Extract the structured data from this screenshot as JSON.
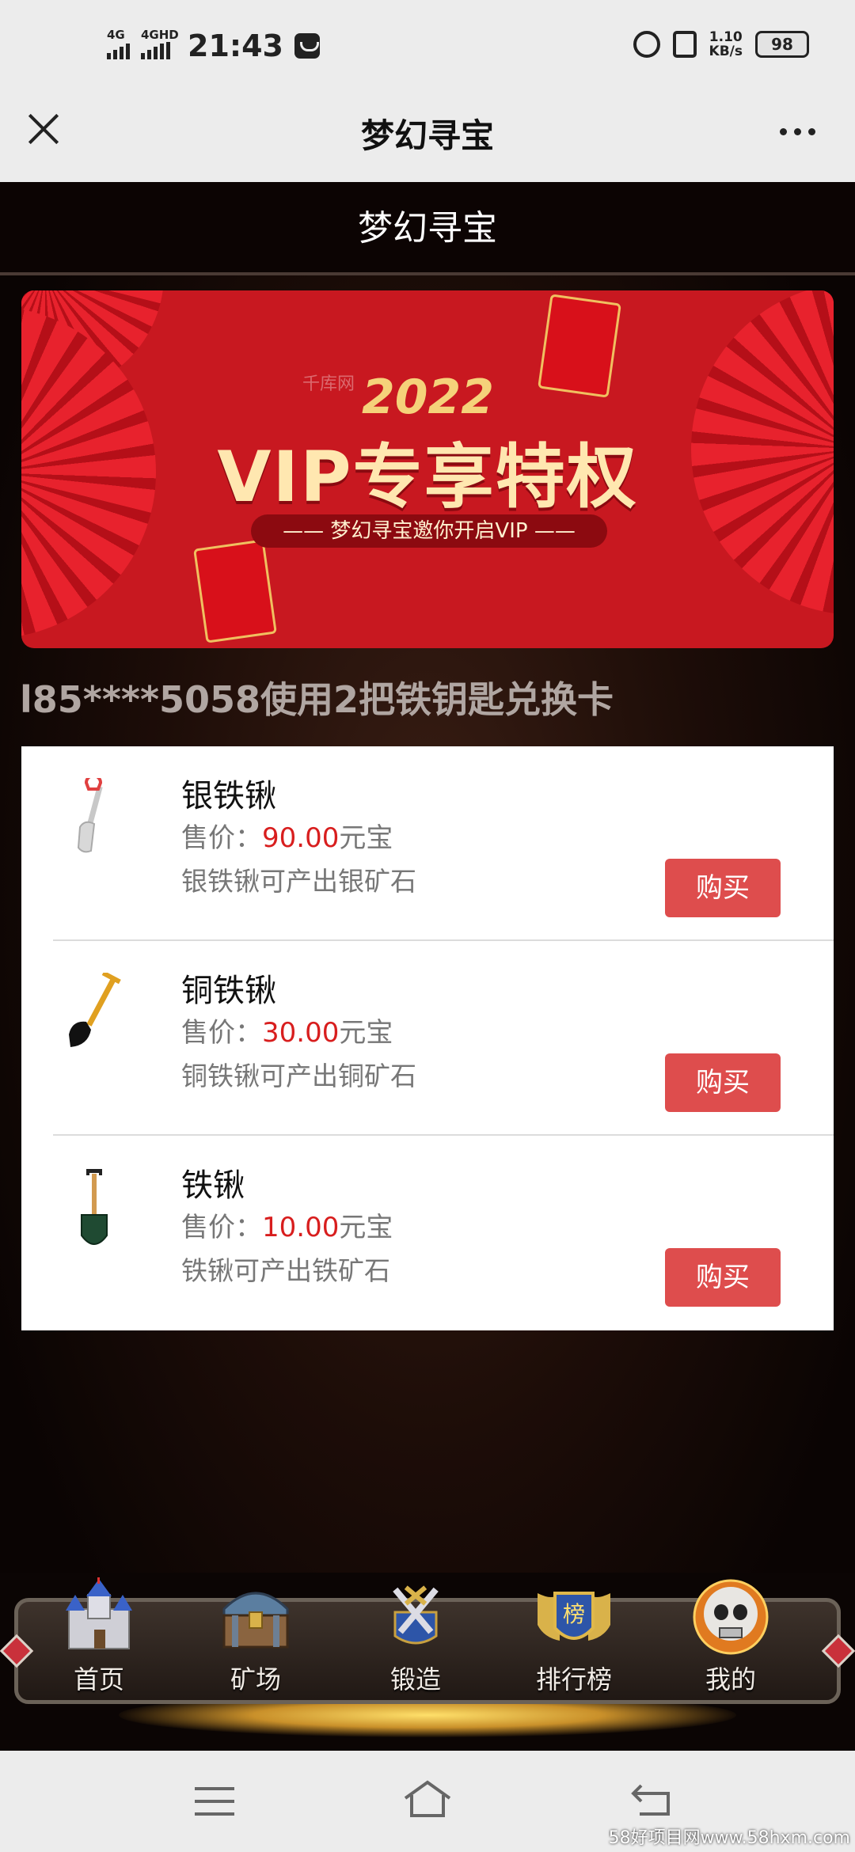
{
  "status_bar": {
    "net1": "4G",
    "net2": "4GHD",
    "time": "21:43",
    "speed_value": "1.10",
    "speed_unit": "KB/s",
    "battery": "98"
  },
  "nav": {
    "title": "梦幻寻宝"
  },
  "page": {
    "header_title": "梦幻寻宝",
    "banner": {
      "year": "2022",
      "title": "VIP专享特权",
      "subtitle": "—— 梦幻寻宝邀你开启VIP ——",
      "faint_text": "千库网"
    },
    "marquee": "l85****5058使用2把铁钥匙兑换卡"
  },
  "shop": {
    "price_label": "售价：",
    "currency": "元宝",
    "buy_label": "购买",
    "items": [
      {
        "name": "银铁锹",
        "price": "90.00",
        "desc": "银铁锹可产出银矿石",
        "icon": "silver-shovel-icon"
      },
      {
        "name": "铜铁锹",
        "price": "30.00",
        "desc": "铜铁锹可产出铜矿石",
        "icon": "copper-shovel-icon"
      },
      {
        "name": "铁锹",
        "price": "10.00",
        "desc": "铁锹可产出铁矿石",
        "icon": "iron-shovel-icon"
      }
    ]
  },
  "tabs": [
    {
      "label": "首页",
      "icon": "castle-icon"
    },
    {
      "label": "矿场",
      "icon": "treasure-chest-icon"
    },
    {
      "label": "锻造",
      "icon": "crossed-swords-icon"
    },
    {
      "label": "排行榜",
      "icon": "ranking-shield-icon",
      "badge": "榜"
    },
    {
      "label": "我的",
      "icon": "skull-avatar-icon"
    }
  ],
  "watermark": "58好项目网www.58hxm.com",
  "colors": {
    "price_red": "#d81e1e",
    "buy_button": "#de4d4d",
    "banner_red": "#c81820"
  }
}
